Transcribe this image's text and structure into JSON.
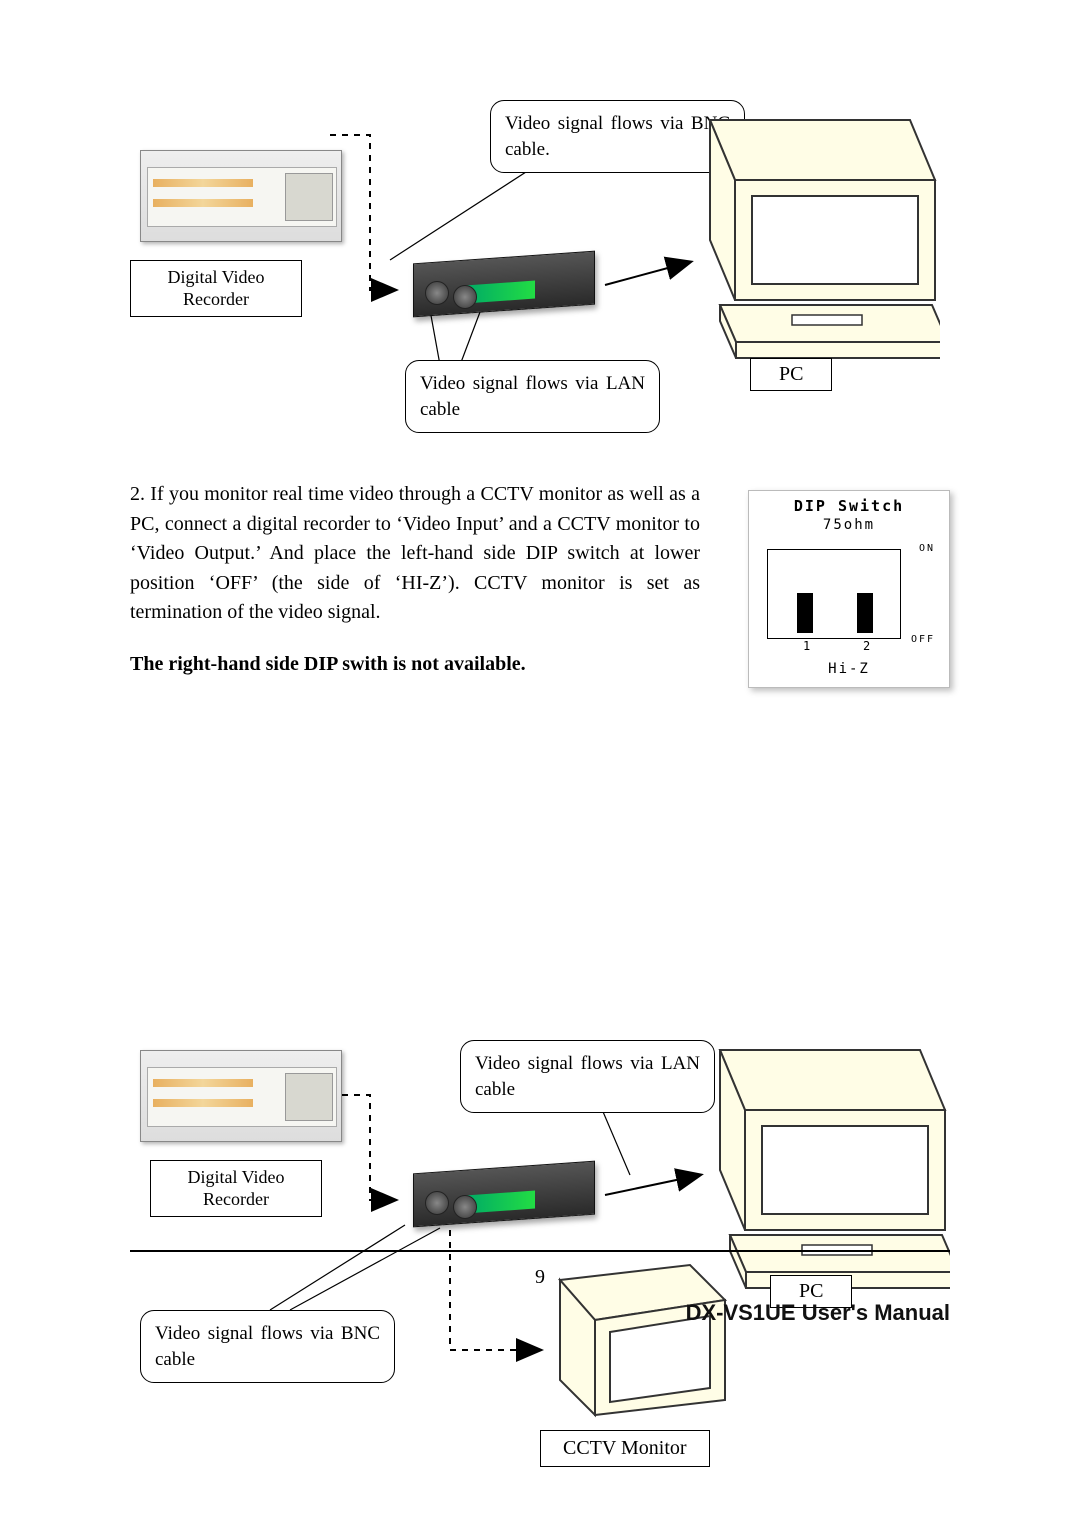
{
  "diagram1": {
    "dvr_label": "Digital Video\nRecorder",
    "callout_bnc": "Video signal flows via BNC cable.",
    "callout_lan": "Video signal flows via LAN cable",
    "pc_label": "PC"
  },
  "paragraph": {
    "text": "2. If you monitor real time video through a CCTV monitor as well as a PC, connect a digital recorder to ‘Video Input’ and a CCTV monitor to ‘Video Output.’ And place the left-hand side DIP switch at lower position ‘OFF’ (the side of ‘HI-Z’). CCTV monitor is set as termination of the video signal.",
    "bold": "The right-hand side DIP swith is not available."
  },
  "dip": {
    "title": "DIP Switch",
    "ohm": "75ohm",
    "on": "ON",
    "off": "OFF",
    "n1": "1",
    "n2": "2",
    "hiz": "Hi-Z"
  },
  "diagram2": {
    "dvr_label": "Digital Video\nRecorder",
    "callout_lan": "Video signal flows via LAN cable",
    "callout_bnc": "Video signal flows via BNC cable",
    "pc_label": "PC",
    "cctv_label": "CCTV Monitor"
  },
  "footer": {
    "page": "9",
    "manual": "DX-VS1UE User's Manual"
  }
}
